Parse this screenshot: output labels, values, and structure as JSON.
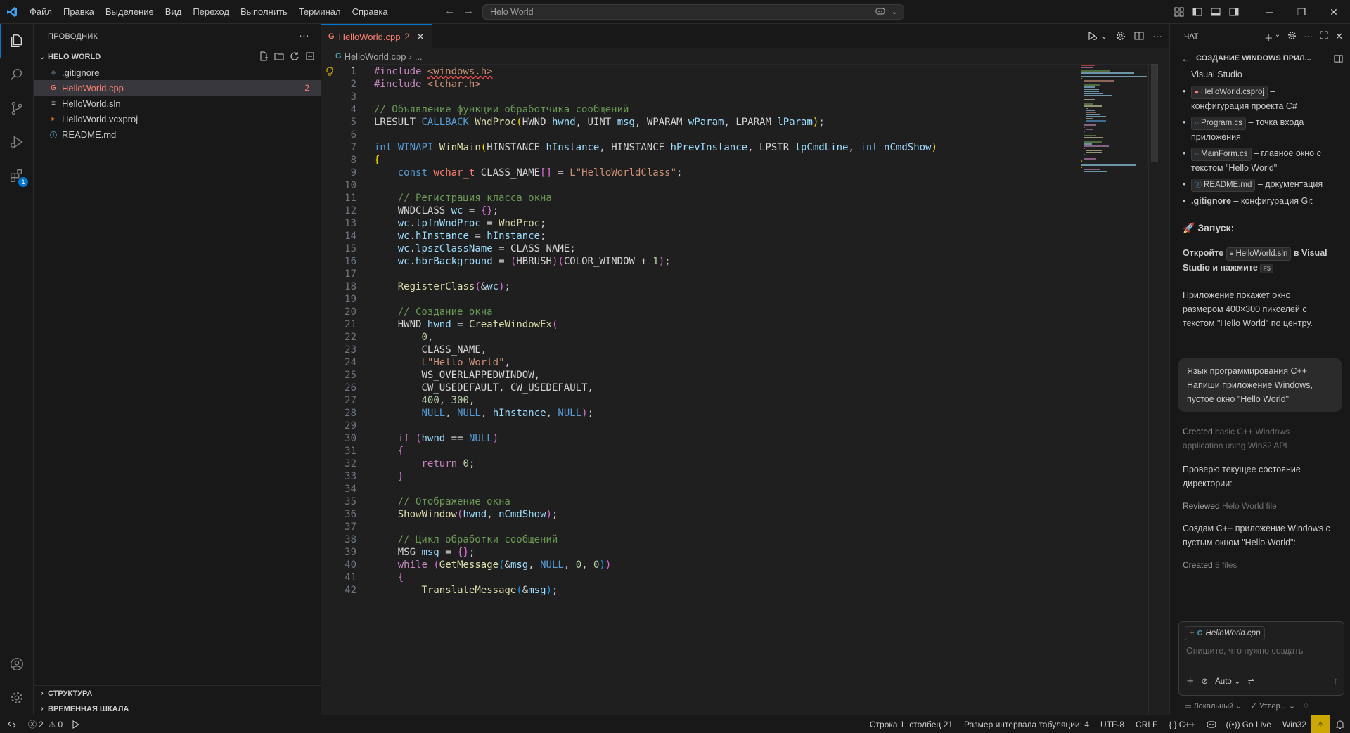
{
  "titlebar": {
    "menu": [
      "Файл",
      "Правка",
      "Выделение",
      "Вид",
      "Переход",
      "Выполнить",
      "Терминал",
      "Справка"
    ],
    "search_text": "Helo World"
  },
  "activity": {
    "extensions_badge": "1"
  },
  "explorer": {
    "title": "ПРОВОДНИК",
    "folder": "HELO WORLD",
    "files": [
      {
        "name": ".gitignore",
        "icon": "gitignore-icon"
      },
      {
        "name": "HelloWorld.cpp",
        "icon": "cpp-icon",
        "count": "2"
      },
      {
        "name": "HelloWorld.sln",
        "icon": "sln-icon"
      },
      {
        "name": "HelloWorld.vcxproj",
        "icon": "vcxproj-icon"
      },
      {
        "name": "README.md",
        "icon": "info-icon"
      }
    ],
    "outline": "СТРУКТУРА",
    "timeline": "ВРЕМЕННАЯ ШКАЛА"
  },
  "editor": {
    "tab_name": "HelloWorld.cpp",
    "tab_count": "2",
    "breadcrumb_file": "HelloWorld.cpp",
    "breadcrumb_more": "...",
    "code": [
      "#include <windows.h>",
      "#include <tchar.h>",
      "",
      "// Объявление функции обработчика сообщений",
      "LRESULT CALLBACK WndProc(HWND hwnd, UINT msg, WPARAM wParam, LPARAM lParam);",
      "",
      "int WINAPI WinMain(HINSTANCE hInstance, HINSTANCE hPrevInstance, LPSTR lpCmdLine, int nCmdShow)",
      "{",
      "    const wchar_t CLASS_NAME[] = L\"HelloWorldClass\";",
      "",
      "    // Регистрация класса окна",
      "    WNDCLASS wc = {};",
      "    wc.lpfnWndProc = WndProc;",
      "    wc.hInstance = hInstance;",
      "    wc.lpszClassName = CLASS_NAME;",
      "    wc.hbrBackground = (HBRUSH)(COLOR_WINDOW + 1);",
      "",
      "    RegisterClass(&wc);",
      "",
      "    // Создание окна",
      "    HWND hwnd = CreateWindowEx(",
      "        0,",
      "        CLASS_NAME,",
      "        L\"Hello World\",",
      "        WS_OVERLAPPEDWINDOW,",
      "        CW_USEDEFAULT, CW_USEDEFAULT,",
      "        400, 300,",
      "        NULL, NULL, hInstance, NULL);",
      "",
      "    if (hwnd == NULL)",
      "    {",
      "        return 0;",
      "    }",
      "",
      "    // Отображение окна",
      "    ShowWindow(hwnd, nCmdShow);",
      "",
      "    // Цикл обработки сообщений",
      "    MSG msg = {};",
      "    while (GetMessage(&msg, NULL, 0, 0))",
      "    {",
      "        TranslateMessage(&msg);"
    ]
  },
  "chat": {
    "header": "ЧАТ",
    "title": "СОЗДАНИЕ WINDOWS ПРИЛ...",
    "line_vs": "Visual Studio",
    "items": [
      {
        "chip": "HelloWorld.csproj",
        "text1": " –",
        "text2": "конфигурация проекта C#"
      },
      {
        "chip": "Program.cs",
        "text1": " – точка входа",
        "text2": "приложения"
      },
      {
        "chip": "MainForm.cs",
        "text1": " – главное окно с",
        "text2": "текстом \"Hello World\""
      },
      {
        "chip": "README.md",
        "text1": " – документация",
        "text2": ""
      }
    ],
    "gitignore_bold": ".gitignore",
    "gitignore_text": " – конфигурация Git",
    "launch_title": "🚀 Запуск:",
    "open_prefix": "Откройте ",
    "open_chip": "HelloWorld.sln",
    "open_mid": " в Visual",
    "open_line2": "Studio и нажмите ",
    "open_key": "F5",
    "app_text_1": "Приложение покажет окно",
    "app_text_2": "размером 400×300 пикселей с",
    "app_text_3": "текстом \"Hello World\" по центру.",
    "user_1": "Язык программирования C++",
    "user_2": "Напиши приложение Windows,",
    "user_3": "пустое окно \"Hello World\"",
    "created_label": "Created",
    "created_text_1": " basic C++ Windows",
    "created_text_2": "application using Win32 API",
    "check_1": "Проверю текущее состояние",
    "check_2": "директории:",
    "reviewed_label": "Reviewed",
    "reviewed_text": " Helo World file",
    "create_1": "Создам C++ приложение Windows с",
    "create_2": "пустым окном \"Hello World\":",
    "created2_label": "Created",
    "created2_text": " 5 files",
    "input_attachment": "HelloWorld.cpp",
    "input_placeholder": "Опишите, что нужно создать",
    "mode": "Auto",
    "footer_local": "Локальный",
    "footer_approve": "Утвер..."
  },
  "status": {
    "errors": "2",
    "warnings": "0",
    "position": "Строка 1, столбец 21",
    "indent": "Размер интервала табуляции: 4",
    "encoding": "UTF-8",
    "eol": "CRLF",
    "language": "C++",
    "golive": "Go Live",
    "platform": "Win32"
  }
}
